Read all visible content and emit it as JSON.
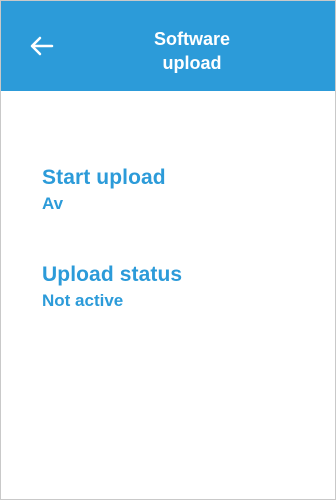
{
  "header": {
    "title_line1": "Software",
    "title_line2": "upload",
    "back_icon": "left-arrow-icon",
    "background_color": "#2c9bd9",
    "text_color": "#ffffff"
  },
  "settings": [
    {
      "label": "Start upload",
      "value": "Av"
    },
    {
      "label": "Upload status",
      "value": "Not active"
    }
  ],
  "accent_color": "#2c9bd9"
}
